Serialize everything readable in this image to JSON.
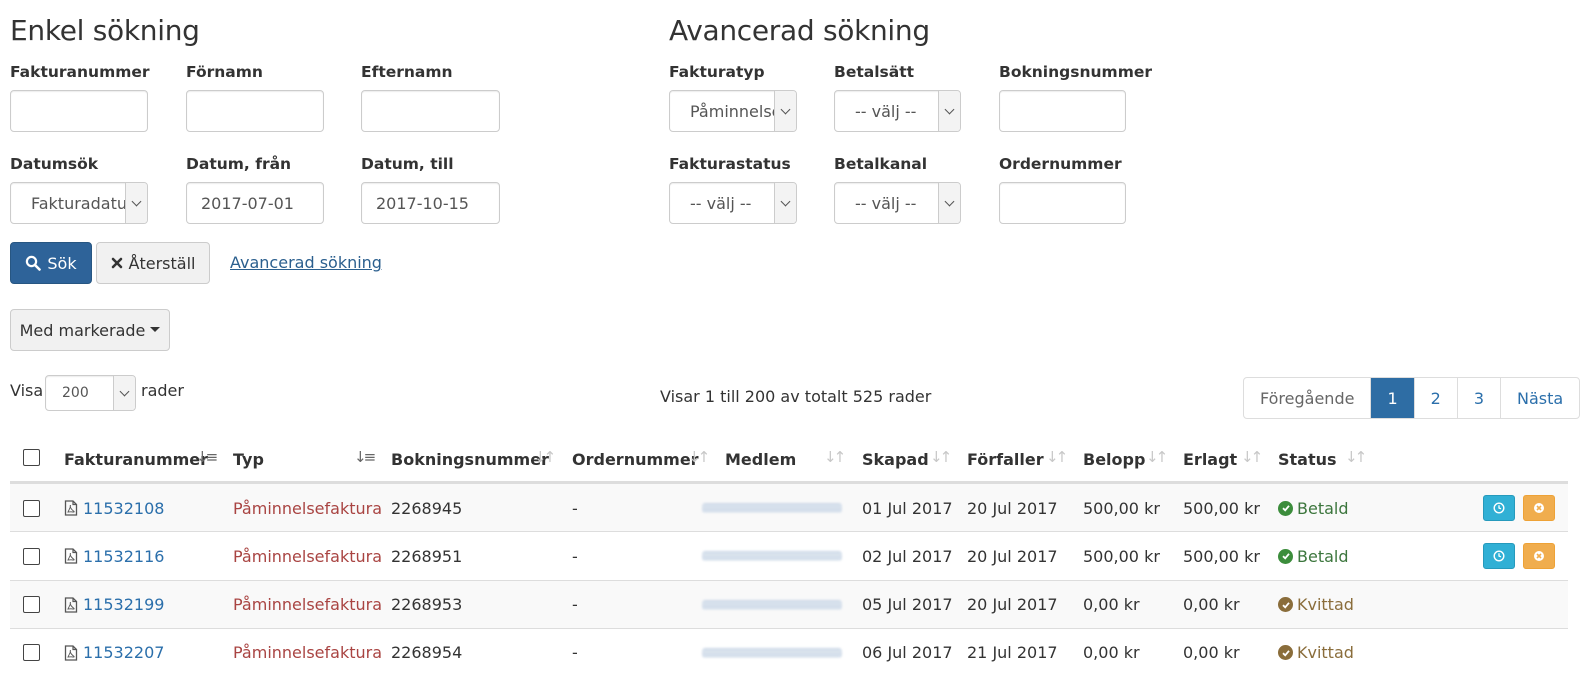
{
  "simple": {
    "title": "Enkel sökning",
    "fields": {
      "fakturanummer": {
        "label": "Fakturanummer",
        "value": ""
      },
      "fornamn": {
        "label": "Förnamn",
        "value": ""
      },
      "efternamn": {
        "label": "Efternamn",
        "value": ""
      },
      "datumsok": {
        "label": "Datumsök",
        "value": "Fakturadatum"
      },
      "datum_fran": {
        "label": "Datum, från",
        "value": "2017-07-01"
      },
      "datum_till": {
        "label": "Datum, till",
        "value": "2017-10-15"
      }
    },
    "buttons": {
      "search": "Sök",
      "reset": "Återställ",
      "advanced_link": "Avancerad sökning"
    }
  },
  "advanced": {
    "title": "Avancerad sökning",
    "fields": {
      "fakturatyp": {
        "label": "Fakturatyp",
        "value": "Påminnelsefaktura"
      },
      "betalsatt": {
        "label": "Betalsätt",
        "value": "-- välj --"
      },
      "bokningsnummer": {
        "label": "Bokningsnummer",
        "value": ""
      },
      "fakturastatus": {
        "label": "Fakturastatus",
        "value": "-- välj --"
      },
      "betalkanal": {
        "label": "Betalkanal",
        "value": "-- välj --"
      },
      "ordernummer": {
        "label": "Ordernummer",
        "value": ""
      }
    }
  },
  "bulk": {
    "label": "Med markerade"
  },
  "table_controls": {
    "show_label": "Visa",
    "rows_value": "200",
    "rows_label": "rader",
    "summary": "Visar 1 till 200 av totalt 525 rader",
    "pagination": {
      "prev": "Föregående",
      "pages": [
        "1",
        "2",
        "3"
      ],
      "active_page": "1",
      "next": "Nästa"
    }
  },
  "table": {
    "columns": [
      "Fakturanummer",
      "Typ",
      "Bokningsnummer",
      "Ordernummer",
      "Medlem",
      "Skapad",
      "Förfaller",
      "Belopp",
      "Erlagt",
      "Status"
    ],
    "rows": [
      {
        "fakturanummer": "11532108",
        "typ": "Påminnelsefaktura",
        "bokningsnummer": "2268945",
        "ordernummer": "-",
        "skapad": "01 Jul 2017",
        "forfaller": "20 Jul 2017",
        "belopp": "500,00 kr",
        "erlagt": "500,00 kr",
        "status": "Betald"
      },
      {
        "fakturanummer": "11532116",
        "typ": "Påminnelsefaktura",
        "bokningsnummer": "2268951",
        "ordernummer": "-",
        "skapad": "02 Jul 2017",
        "forfaller": "20 Jul 2017",
        "belopp": "500,00 kr",
        "erlagt": "500,00 kr",
        "status": "Betald"
      },
      {
        "fakturanummer": "11532199",
        "typ": "Påminnelsefaktura",
        "bokningsnummer": "2268953",
        "ordernummer": "-",
        "skapad": "05 Jul 2017",
        "forfaller": "20 Jul 2017",
        "belopp": "0,00 kr",
        "erlagt": "0,00 kr",
        "status": "Kvittad"
      },
      {
        "fakturanummer": "11532207",
        "typ": "Påminnelsefaktura",
        "bokningsnummer": "2268954",
        "ordernummer": "-",
        "skapad": "06 Jul 2017",
        "forfaller": "21 Jul 2017",
        "belopp": "0,00 kr",
        "erlagt": "0,00 kr",
        "status": "Kvittad"
      }
    ]
  },
  "colors": {
    "primary": "#2e6399",
    "link": "#2b6fab",
    "type_text": "#a94442",
    "status_paid": "#3c763d",
    "status_offset": "#8a6d3b",
    "info_button": "#31b0d5",
    "warning_button": "#f0ad4e"
  }
}
